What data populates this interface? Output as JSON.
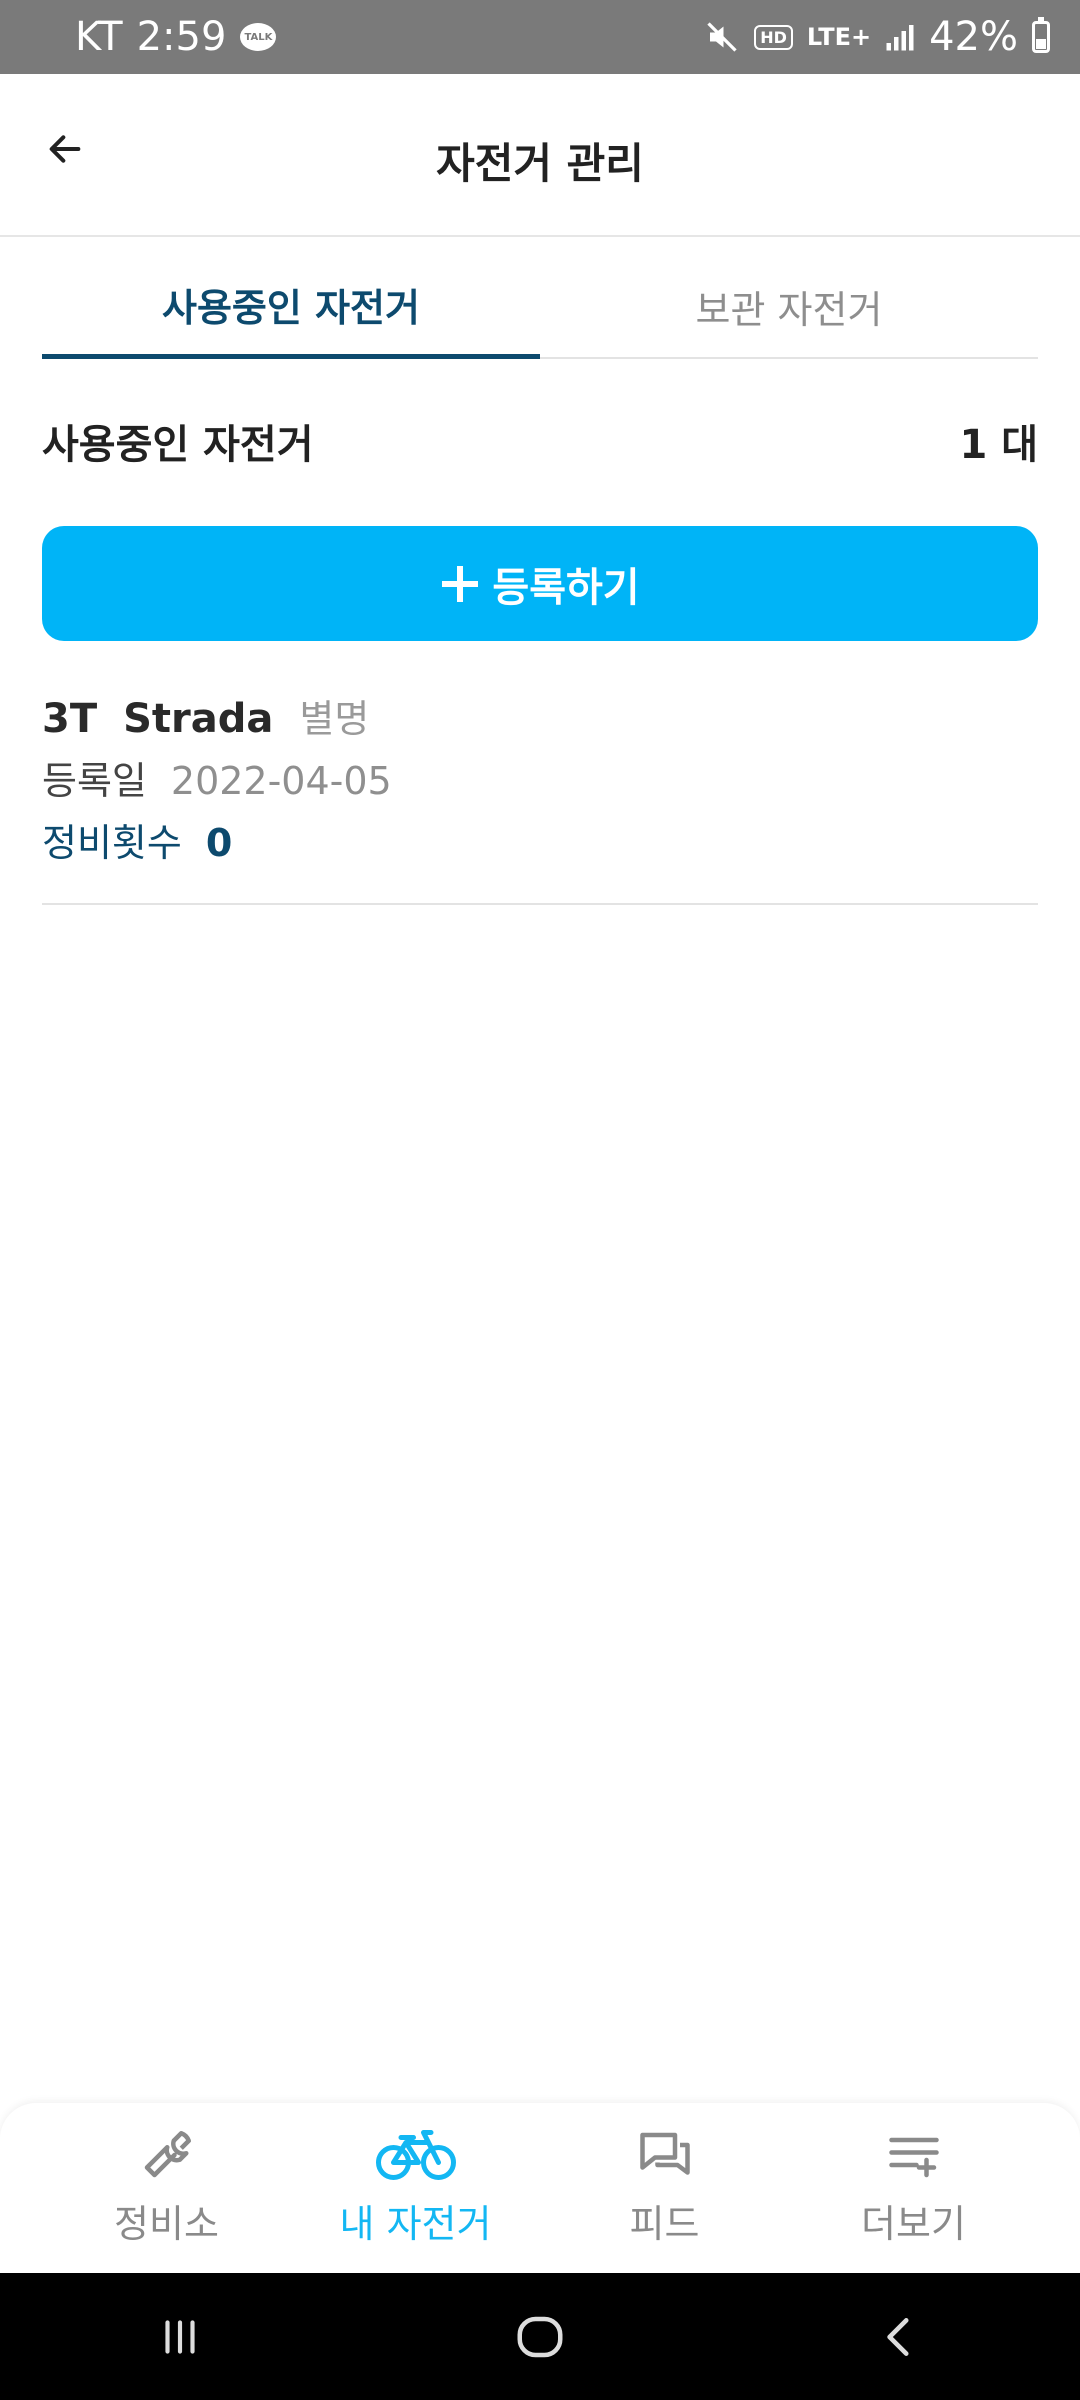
{
  "status_bar": {
    "carrier": "KT",
    "time": "2:59",
    "talk_badge": "TALK",
    "hd": "HD",
    "network": "LTE+",
    "battery": "42%"
  },
  "header": {
    "title": "자전거 관리"
  },
  "tabs": [
    {
      "label": "사용중인 자전거",
      "active": true
    },
    {
      "label": "보관 자전거",
      "active": false
    }
  ],
  "count": {
    "label": "사용중인 자전거",
    "value": "1 대"
  },
  "register_button": {
    "label": "등록하기"
  },
  "bikes": [
    {
      "brand": "3T",
      "model": "Strada",
      "nickname": "별명",
      "registered_label": "등록일",
      "registered_date": "2022-04-05",
      "maintenance_label": "정비횟수",
      "maintenance_count": "0"
    }
  ],
  "bottom_nav": [
    {
      "label": "정비소",
      "icon": "wrench-icon",
      "active": false
    },
    {
      "label": "내 자전거",
      "icon": "bicycle-icon",
      "active": true
    },
    {
      "label": "피드",
      "icon": "chat-bubbles-icon",
      "active": false
    },
    {
      "label": "더보기",
      "icon": "menu-plus-icon",
      "active": false
    }
  ],
  "colors": {
    "accent": "#00b4f7",
    "primary_dark": "#0d4a6e",
    "nav_active": "#13b7f3"
  }
}
